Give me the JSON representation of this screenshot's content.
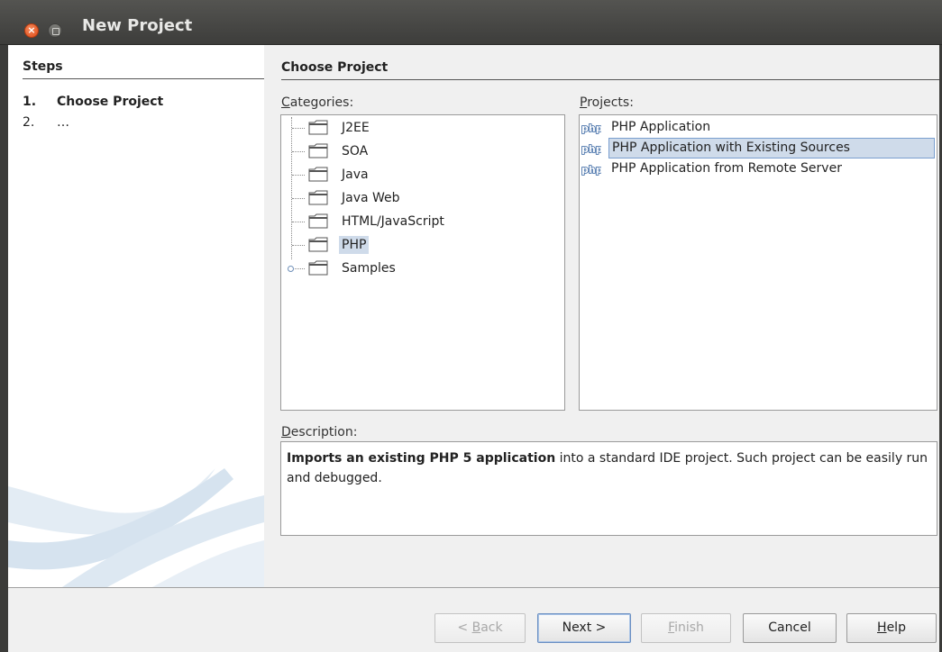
{
  "window": {
    "title": "New Project",
    "close_glyph": "×"
  },
  "steps": {
    "heading": "Steps",
    "items": [
      {
        "num": "1.",
        "label": "Choose Project"
      },
      {
        "num": "2.",
        "label": "…"
      }
    ]
  },
  "main": {
    "heading": "Choose Project",
    "categories_label": {
      "mn": "C",
      "rest": "ategories:"
    },
    "projects_label": {
      "mn": "P",
      "rest": "rojects:"
    },
    "description_label": {
      "mn": "D",
      "rest": "escription:"
    }
  },
  "categories": {
    "items": [
      {
        "label": "J2EE",
        "icon": "folder-icon"
      },
      {
        "label": "SOA",
        "icon": "folder-icon"
      },
      {
        "label": "Java",
        "icon": "folder-icon"
      },
      {
        "label": "Java Web",
        "icon": "folder-icon"
      },
      {
        "label": "HTML/JavaScript",
        "icon": "folder-icon"
      },
      {
        "label": "PHP",
        "icon": "folder-icon",
        "selected": true
      },
      {
        "label": "Samples",
        "icon": "folder-icon",
        "expandable": true
      }
    ]
  },
  "projects": {
    "items": [
      {
        "label": "PHP Application",
        "icon": "php-icon"
      },
      {
        "label": "PHP Application with Existing Sources",
        "icon": "php-icon",
        "selected": true
      },
      {
        "label": "PHP Application from Remote Server",
        "icon": "php-icon"
      }
    ]
  },
  "description": {
    "bold": "Imports an existing PHP 5 application",
    "rest": " into a standard IDE project. Such project can be easily run and debugged."
  },
  "buttons": {
    "back": {
      "pre": "< ",
      "mn": "B",
      "rest": "ack",
      "enabled": false
    },
    "next": {
      "label": "Next >",
      "enabled": true
    },
    "finish": {
      "mn": "F",
      "rest": "inish",
      "enabled": false
    },
    "cancel": {
      "label": "Cancel",
      "enabled": true
    },
    "help": {
      "mn": "H",
      "rest": "elp",
      "enabled": true
    }
  },
  "colors": {
    "titlebar": "#3d3d3b",
    "selection": "#cfdbea",
    "close_button": "#df4a16"
  }
}
